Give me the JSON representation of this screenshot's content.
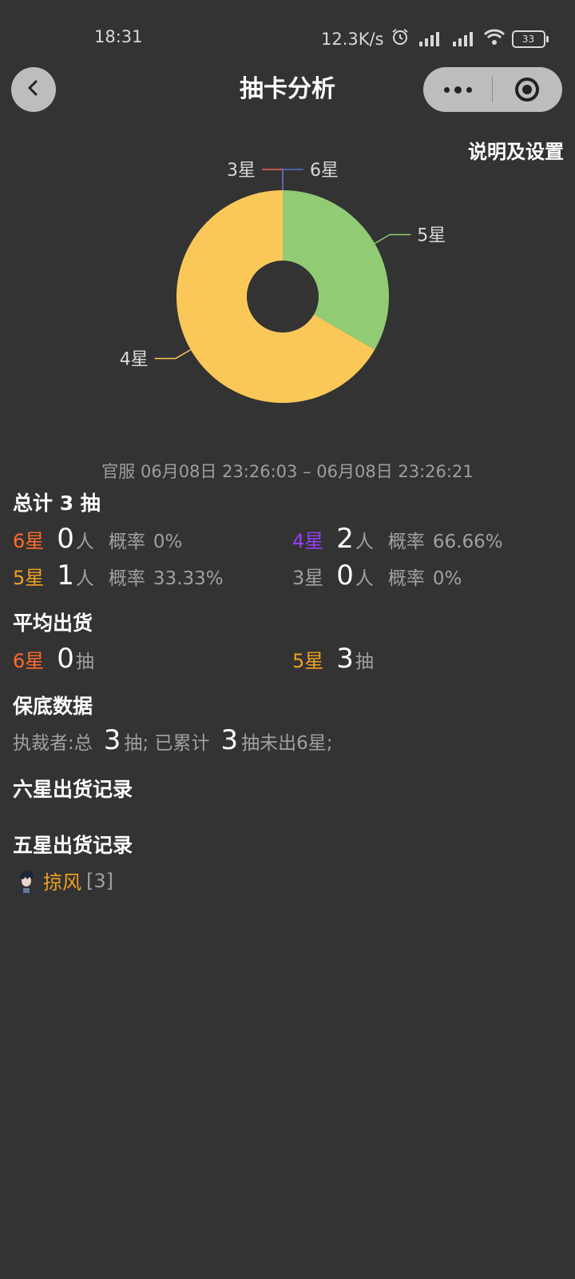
{
  "status_bar": {
    "time": "18:31",
    "net_speed": "12.3K/s",
    "battery": "33",
    "icons": [
      "alarm-icon",
      "hd-signal-icon",
      "hd-signal-icon",
      "wifi-icon",
      "battery-icon"
    ]
  },
  "header": {
    "title": "抽卡分析",
    "back_icon": "chevron-left-icon",
    "more_icon": "more-dots-icon",
    "close_icon": "target-icon"
  },
  "settings_link": "说明及设置",
  "chart_data": {
    "type": "pie",
    "style": "donut",
    "categories": [
      "5星",
      "4星",
      "3星",
      "6星"
    ],
    "values": [
      1,
      2,
      0,
      0
    ],
    "colors": [
      "#91cc75",
      "#fac858",
      "#ee6666",
      "#5470c6"
    ],
    "title": "",
    "legend": "none"
  },
  "period": "官服  06月08日 23:26:03  –  06月08日 23:26:21",
  "summary": {
    "title": "总计 3 抽",
    "person_unit": "人",
    "rate_label": "概率",
    "rows": [
      [
        {
          "star": "6星",
          "count": "0",
          "rate": "0%",
          "color": "#ff6a2a"
        },
        {
          "star": "4星",
          "count": "2",
          "rate": "66.66%",
          "color": "#9a3cf2"
        }
      ],
      [
        {
          "star": "5星",
          "count": "1",
          "rate": "33.33%",
          "color": "#f0a020"
        },
        {
          "star": "3星",
          "count": "0",
          "rate": "0%",
          "color": "#a0a0a0"
        }
      ]
    ]
  },
  "average": {
    "title": "平均出货",
    "unit": "抽",
    "items": [
      {
        "star": "6星",
        "value": "0",
        "color": "#ff6a2a"
      },
      {
        "star": "5星",
        "value": "3",
        "color": "#f0a020"
      }
    ]
  },
  "pity": {
    "title": "保底数据",
    "label_total": "执裁者:总",
    "total": "3",
    "unit_total": "抽; 已累计",
    "accumulated": "3",
    "suffix": "抽未出6星;"
  },
  "six_star_records": {
    "title": "六星出货记录"
  },
  "five_star_records": {
    "title": "五星出货记录",
    "items": [
      {
        "name": "掠风",
        "pulls": "[3]",
        "avatar_icon": "character-avatar-icon"
      }
    ]
  }
}
